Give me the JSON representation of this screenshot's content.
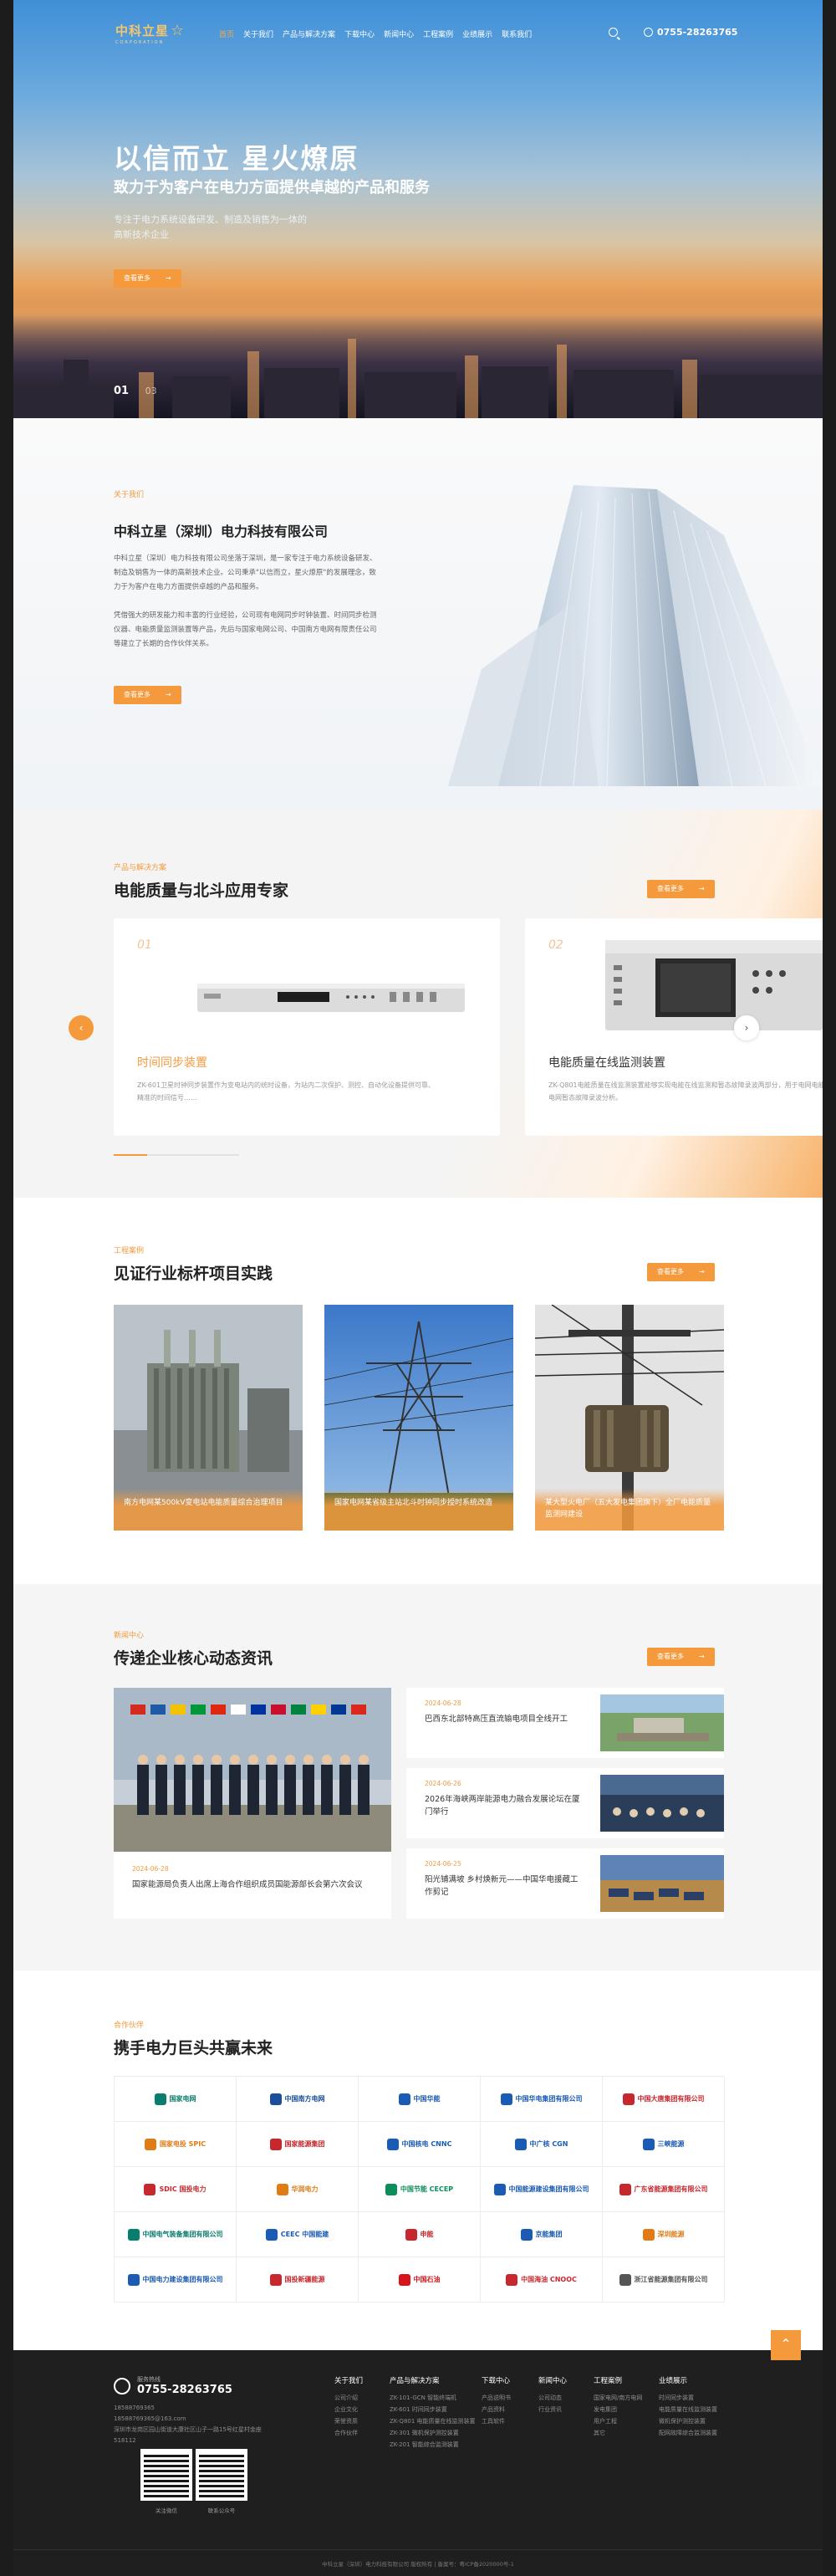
{
  "header": {
    "logo": "中科立星",
    "logo_sub": "CORPORATION",
    "nav": [
      "首页",
      "关于我们",
      "产品与解决方案",
      "下载中心",
      "新闻中心",
      "工程案例",
      "业绩展示",
      "联系我们"
    ],
    "phone": "0755-28263765"
  },
  "hero": {
    "title": "以信而立  星火燎原",
    "subtitle": "致力于为客户在电力方面提供卓越的产品和服务",
    "desc1": "专注于电力系统设备研发、制造及销售为一体的",
    "desc2": "高新技术企业",
    "button": "查看更多",
    "pager_current": "01",
    "pager_total": "03"
  },
  "about": {
    "eyebrow": "关于我们",
    "title": "中科立星（深圳）电力科技有限公司",
    "p1": "中科立星（深圳）电力科技有限公司坐落于深圳，是一家专注于电力系统设备研发、制造及销售为一体的高新技术企业。公司秉承\"以信而立，星火燎原\"的发展理念，致力于为客户在电力方面提供卓越的产品和服务。",
    "p2": "凭借强大的研发能力和丰富的行业经验，公司现有电网同步时钟装置、时间同步检测仪器、电能质量监测装置等产品，先后与国家电网公司、中国南方电网有限责任公司等建立了长期的合作伙伴关系。",
    "button": "查看更多"
  },
  "products": {
    "eyebrow": "产品与解决方案",
    "title": "电能质量与北斗应用专家",
    "button": "查看更多",
    "items": [
      {
        "num": "01",
        "name": "时间同步装置",
        "desc": "ZK-601卫星时钟同步装置作为变电站内的统时设备，为站内二次保护、测控、自动化设备提供可靠、精准的时间信号……"
      },
      {
        "num": "02",
        "name": "电能质量在线监测装置",
        "desc": "ZK-Q801电能质量在线监测装置能够实现电能在线监测和暂态故障录波两部分，用于电网电能监测和电网暂态故障录波分析。"
      }
    ]
  },
  "cases": {
    "eyebrow": "工程案例",
    "title": "见证行业标杆项目实践",
    "button": "查看更多",
    "items": [
      {
        "caption": "南方电网某500kV变电站电能质量综合治理项目"
      },
      {
        "caption": "国家电网某省级主站北斗时钟同步授时系统改造"
      },
      {
        "caption": "某大型火电厂（五大发电集团旗下）全厂电能质量监测网建设"
      }
    ]
  },
  "news": {
    "eyebrow": "新闻中心",
    "title": "传递企业核心动态资讯",
    "button": "查看更多",
    "featured": {
      "date": "2024-06-28",
      "title": "国家能源局负责人出席上海合作组织成员国能源部长会第六次会议"
    },
    "items": [
      {
        "date": "2024-06-28",
        "title": "巴西东北部特高压直流输电项目全线开工"
      },
      {
        "date": "2024-06-26",
        "title": "2026年海峡两岸能源电力融合发展论坛在厦门举行"
      },
      {
        "date": "2024-06-25",
        "title": "阳光铺满坡 乡村焕新元——中国华电援藏工作剪记"
      }
    ]
  },
  "partners": {
    "eyebrow": "合作伙伴",
    "title": "携手电力巨头共赢未来",
    "logos": [
      {
        "name": "国家电网",
        "color": "#0a7e6e"
      },
      {
        "name": "中国南方电网",
        "color": "#1b4f9c"
      },
      {
        "name": "中国华能",
        "color": "#1a5bb5"
      },
      {
        "name": "中国华电集团有限公司",
        "color": "#1a5bb5"
      },
      {
        "name": "中国大唐集团有限公司",
        "color": "#c7282e"
      },
      {
        "name": "国家电投 SPIC",
        "color": "#e07b16"
      },
      {
        "name": "国家能源集团",
        "color": "#c7282e"
      },
      {
        "name": "中国核电 CNNC",
        "color": "#1a5bb5"
      },
      {
        "name": "中广核 CGN",
        "color": "#1a5bb5"
      },
      {
        "name": "三峡能源",
        "color": "#1a5bb5"
      },
      {
        "name": "SDIC 国投电力",
        "color": "#c7282e"
      },
      {
        "name": "华润电力",
        "color": "#e07b16"
      },
      {
        "name": "中国节能 CECEP",
        "color": "#0a8e5a"
      },
      {
        "name": "中国能源建设集团有限公司",
        "color": "#1a5bb5"
      },
      {
        "name": "广东省能源集团有限公司",
        "color": "#c7282e"
      },
      {
        "name": "中国电气装备集团有限公司",
        "color": "#0a7e6e"
      },
      {
        "name": "CEEC 中国能建",
        "color": "#1a5bb5"
      },
      {
        "name": "申能",
        "color": "#c7282e"
      },
      {
        "name": "京能集团",
        "color": "#1a5bb5"
      },
      {
        "name": "深圳能源",
        "color": "#e07b16"
      },
      {
        "name": "中国电力建设集团有限公司",
        "color": "#1a5bb5"
      },
      {
        "name": "国投新疆能源",
        "color": "#c7282e"
      },
      {
        "name": "中国石油",
        "color": "#d7141a"
      },
      {
        "name": "中国海油 CNOOC",
        "color": "#c7282e"
      },
      {
        "name": "浙江省能源集团有限公司",
        "color": "#555555"
      }
    ]
  },
  "footer": {
    "hotline_label": "服务热线",
    "hotline": "0755-28263765",
    "mobile": "18588769365",
    "email": "18588769365@163.com",
    "address": "深圳市龙岗区园山街道大康社区山子一路15号红星村金座",
    "zip": "518112",
    "qr1": "关注微信",
    "qr2": "联系公众号",
    "columns": [
      {
        "title": "关于我们",
        "items": [
          "公司介绍",
          "企业文化",
          "荣誉资质",
          "合作伙伴"
        ]
      },
      {
        "title": "产品与解决方案",
        "items": [
          "ZK-101-GCN 智能终端机",
          "ZK-601 时间同步装置",
          "ZK-Q801 电能质量在线监测装置",
          "ZK-301 微机保护测控装置",
          "ZK-201 智能综合监测装置"
        ]
      },
      {
        "title": "下载中心",
        "items": [
          "产品说明书",
          "产品资料",
          "工具软件"
        ]
      },
      {
        "title": "新闻中心",
        "items": [
          "公司动态",
          "行业资讯"
        ]
      },
      {
        "title": "工程案例",
        "items": [
          "国家电网/南方电网",
          "发电集团",
          "用户工程",
          "其它"
        ]
      },
      {
        "title": "业绩展示",
        "items": [
          "时间同步装置",
          "电能质量在线监测装置",
          "微机保护测控装置",
          "配网故障综合监测装置"
        ]
      }
    ],
    "copyright": "中科立星（深圳）电力科技有限公司 版权所有 | 备案号：粤ICP备2020000号-1"
  }
}
